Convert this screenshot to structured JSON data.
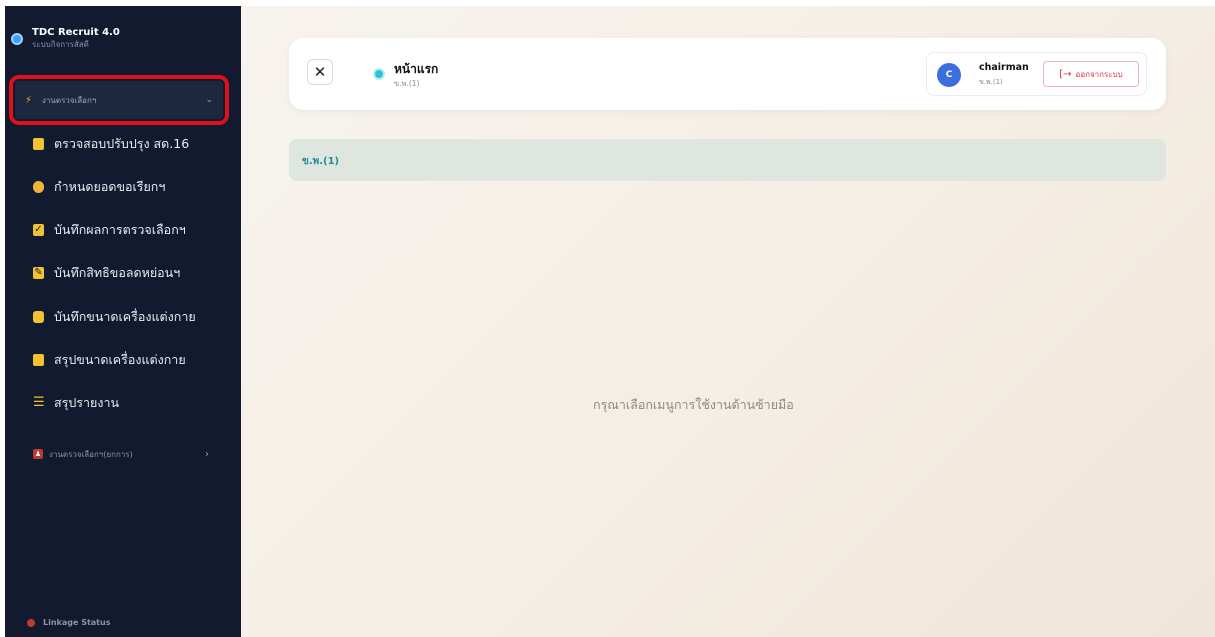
{
  "brand": {
    "title": "TDC Recruit 4.0",
    "subtitle": "ระบบกิจการสัสดี"
  },
  "sidebar": {
    "group": {
      "label": "งานตรวจเลือกฯ",
      "icon": "bolt-icon"
    },
    "items": [
      {
        "label": "ตรวจสอบปรับปรุง สด.16",
        "icon": "clipboard-icon"
      },
      {
        "label": "กำหนดยอดขอเรียกฯ",
        "icon": "hand-icon"
      },
      {
        "label": "บันทึกผลการตรวจเลือกฯ",
        "icon": "checkbox-icon"
      },
      {
        "label": "บันทึกสิทธิขอลดหย่อนฯ",
        "icon": "edit-icon"
      },
      {
        "label": "บันทึกขนาดเครื่องแต่งกาย",
        "icon": "shirt-icon"
      },
      {
        "label": "สรุปขนาดเครื่องแต่งกาย",
        "icon": "document-icon"
      },
      {
        "label": "สรุปรายงาน",
        "icon": "list-icon"
      }
    ],
    "sub_group": {
      "label": "งานตรวจเลือกฯ(ยกการ)",
      "icon": "people-icon"
    },
    "status": "Linkage Status"
  },
  "header": {
    "page_title": "หน้าแรก",
    "page_subtitle": "ข.พ.(1)",
    "user": {
      "avatar_letter": "C",
      "name": "chairman",
      "role": "ข.พ.(1)"
    },
    "logout_label": "ออกจากระบบ"
  },
  "section": {
    "label": "ข.พ.(1)"
  },
  "empty_message": "กรุณาเลือกเมนูการใช้งานด้านซ้ายมือ",
  "colors": {
    "sidebar_bg": "#111a2e",
    "accent": "#2ec4d6",
    "highlight_outline": "#e0101a",
    "logout": "#e0303a"
  }
}
